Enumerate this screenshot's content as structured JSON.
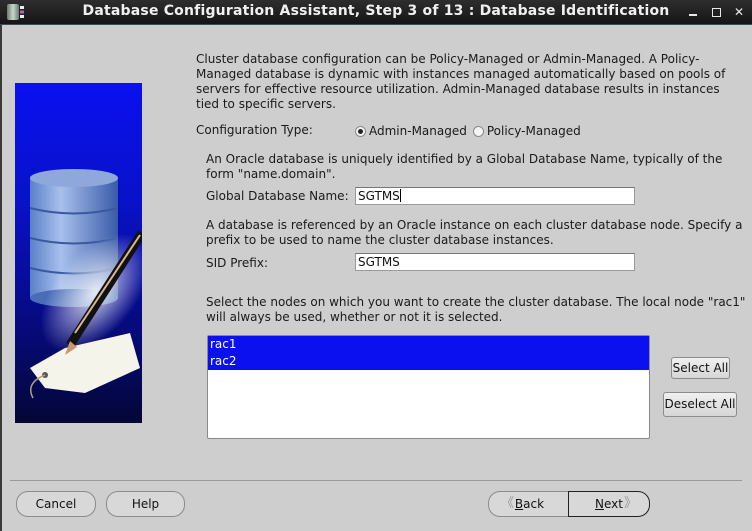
{
  "window": {
    "title": "Database Configuration Assistant, Step 3 of 13 : Database Identification",
    "controls": {
      "minimize": "minimize",
      "maximize": "maximize",
      "close": "✕"
    }
  },
  "intro_text": "Cluster database configuration can be Policy-Managed or Admin-Managed. A Policy-Managed database is dynamic with instances managed automatically based on pools of servers for effective resource utilization. Admin-Managed database results in instances tied to specific servers.",
  "configuration_type": {
    "label": "Configuration Type:",
    "options": [
      {
        "label": "Admin-Managed",
        "selected": true
      },
      {
        "label": "Policy-Managed",
        "selected": false
      }
    ]
  },
  "global_db": {
    "description": "An Oracle database is uniquely identified by a Global Database Name, typically of the form \"name.domain\".",
    "label": "Global Database Name:",
    "value": "SGTMS"
  },
  "sid": {
    "description": "A database is referenced by an Oracle instance on each cluster database node. Specify a prefix to be used to name the cluster database instances.",
    "label": "SID Prefix:",
    "value": "SGTMS"
  },
  "nodes": {
    "description": "Select the nodes on which you want to create the cluster database. The local node \"rac1\" will always be used, whether or not it is selected.",
    "items": [
      {
        "label": "rac1",
        "selected": true
      },
      {
        "label": "rac2",
        "selected": true
      }
    ],
    "select_all": "Select All",
    "deselect_all": "Deselect All"
  },
  "footer": {
    "cancel": "Cancel",
    "help": "Help",
    "back_prefix": "",
    "back_mnemonic": "B",
    "back_rest": "ack",
    "next_mnemonic": "N",
    "next_rest": "ext",
    "back_chevron": "《",
    "next_chevron": "》"
  },
  "colors": {
    "selection": "#0a10f0",
    "background": "#cecece",
    "titlebar": "#1c1c1c"
  }
}
